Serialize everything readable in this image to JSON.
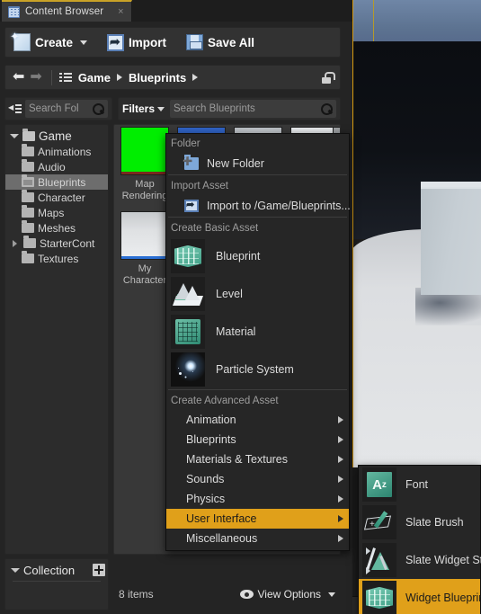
{
  "window": {
    "tab": {
      "title": "Content Browser",
      "icon": "content-browser-icon",
      "close": "×"
    }
  },
  "toolbar": {
    "create_label": "Create",
    "import_label": "Import",
    "save_all_label": "Save All"
  },
  "breadcrumb": {
    "back": "⬅",
    "forward": "➡",
    "items": [
      {
        "label": "Game"
      },
      {
        "label": "Blueprints"
      }
    ],
    "lock_icon": "lock-icon"
  },
  "search": {
    "folder_placeholder": "Search Fol",
    "filters_label": "Filters",
    "asset_placeholder": "Search Blueprints"
  },
  "folder_tree": {
    "root": {
      "label": "Game",
      "expanded": true
    },
    "items": [
      {
        "label": "Animations",
        "selected": false,
        "expandable": false
      },
      {
        "label": "Audio",
        "selected": false,
        "expandable": false
      },
      {
        "label": "Blueprints",
        "selected": true,
        "expandable": false
      },
      {
        "label": "Character",
        "selected": false,
        "expandable": false
      },
      {
        "label": "Maps",
        "selected": false,
        "expandable": false
      },
      {
        "label": "Meshes",
        "selected": false,
        "expandable": false
      },
      {
        "label": "StarterCont",
        "selected": false,
        "expandable": true
      },
      {
        "label": "Textures",
        "selected": false,
        "expandable": false
      }
    ]
  },
  "collections": {
    "title": "Collection",
    "add_label": "+"
  },
  "assets": [
    {
      "name": "Map\nRendering",
      "color": "#00ee00",
      "bar": "#7a2a1e"
    },
    {
      "name": "My\nCharacter",
      "color": "#d7d9db",
      "bar": "#2a6fd4"
    }
  ],
  "asset_strip": [
    {
      "color": "#2f62c4"
    },
    {
      "color": "#e7e9eb"
    },
    {
      "color": "#d2d5d8"
    },
    {
      "color": "#9a9da0"
    }
  ],
  "status": {
    "items_count": "8 items",
    "view_options_label": "View Options",
    "eye_icon": "eye-icon"
  },
  "context_menu": {
    "sections": [
      {
        "header": "Folder",
        "items": [
          {
            "label": "New Folder",
            "icon": "new-folder-icon",
            "size": "small"
          }
        ]
      },
      {
        "header": "Import Asset",
        "items": [
          {
            "label": "Import to /Game/Blueprints...",
            "icon": "import-icon",
            "size": "small"
          }
        ]
      },
      {
        "header": "Create Basic Asset",
        "items": [
          {
            "label": "Blueprint",
            "icon": "blueprint-icon",
            "size": "large"
          },
          {
            "label": "Level",
            "icon": "level-icon",
            "size": "large"
          },
          {
            "label": "Material",
            "icon": "material-icon",
            "size": "large"
          },
          {
            "label": "Particle System",
            "icon": "particle-system-icon",
            "size": "large"
          }
        ]
      },
      {
        "header": "Create Advanced Asset",
        "items": [
          {
            "label": "Animation",
            "submenu": true,
            "highlighted": false
          },
          {
            "label": "Blueprints",
            "submenu": true,
            "highlighted": false
          },
          {
            "label": "Materials & Textures",
            "submenu": true,
            "highlighted": false
          },
          {
            "label": "Sounds",
            "submenu": true,
            "highlighted": false
          },
          {
            "label": "Physics",
            "submenu": true,
            "highlighted": false
          },
          {
            "label": "User Interface",
            "submenu": true,
            "highlighted": true
          },
          {
            "label": "Miscellaneous",
            "submenu": true,
            "highlighted": false
          }
        ]
      }
    ]
  },
  "submenu": {
    "parent": "User Interface",
    "items": [
      {
        "label": "Font",
        "icon": "font-icon",
        "highlighted": false
      },
      {
        "label": "Slate Brush",
        "icon": "slate-brush-icon",
        "highlighted": false
      },
      {
        "label": "Slate Widget Style",
        "icon": "slate-widget-style-icon",
        "highlighted": false
      },
      {
        "label": "Widget Blueprint",
        "icon": "widget-blueprint-icon",
        "highlighted": true
      }
    ]
  },
  "colors": {
    "highlight": "#e0a01a",
    "tab_accent": "#c9a227",
    "panel_bg": "#2c2c2c",
    "menu_bg": "#262626"
  }
}
